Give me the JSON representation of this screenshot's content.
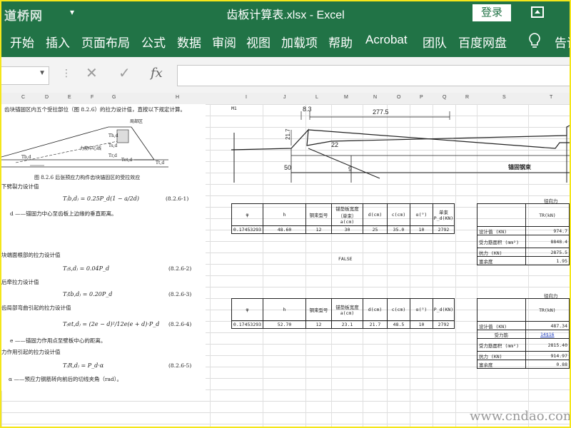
{
  "titlebar": {
    "logo": "道桥网",
    "qat": "▾",
    "title": "齿板计算表.xlsx  -  Excel",
    "login": "登录"
  },
  "ribbon": {
    "tabs": [
      "开始",
      "插入",
      "页面布局",
      "公式",
      "数据",
      "审阅",
      "视图",
      "加载项",
      "帮助",
      "Acrobat",
      "团队",
      "百度网盘",
      "告诉"
    ]
  },
  "formula_bar": {
    "fx": "fx",
    "cancel": "✕",
    "enter": "✓"
  },
  "columns": [
    "C",
    "D",
    "E",
    "F",
    "G",
    "H",
    "I",
    "J",
    "L",
    "M",
    "N",
    "O",
    "P",
    "Q",
    "R",
    "S",
    "T"
  ],
  "book": {
    "lines": [
      "齿块锚固区内五个受拉部位（图 8.2.6）的拉力设计值，直按以下规定计算。",
      "局部区",
      "力筋中心线",
      "图 8.2.6  后张预应力构件齿块锚固区的受拉效应",
      "下劈裂力设计值",
      "d ——锚固力中心至齿板上边缘的垂直距离。",
      "块端面根部的拉力设计值",
      "后牵拉力设计值",
      "齿局部弯曲引起的拉力设计值",
      "e ——锚固力作用点至壁板中心的距离。",
      "力作用引起的拉力设计值",
      "α ——预应力钢筋转向前后的切线夹角（rad）。"
    ],
    "formulas": [
      "T₍b,d₎ = 0.25P_d(1 − a/2d)",
      "T₍s,d₎ = 0.04P_d",
      "T₍tb,d₎ = 0.20P_d",
      "T₍et,d₎ = (2e − d)²/12e(e + d)·P_d",
      "T₍R,d₎ = P_d·α"
    ],
    "eq_numbers": [
      "(8.2.6-1)",
      "(8.2.6-2)",
      "(8.2.6-3)",
      "(8.2.6-4)",
      "(8.2.6-5)"
    ]
  },
  "drawing": {
    "cell_ref": "M1",
    "dims": [
      "8.3",
      "277.5",
      "21.7",
      "22",
      "50",
      "9"
    ],
    "label": "锚固钢束"
  },
  "table1": {
    "headers": [
      "φ",
      "h",
      "钢束型号",
      "锚垫板宽度（单束）a(cm)",
      "d(cm)",
      "c(cm)",
      "α(°)",
      "单束 P_d(KN)"
    ],
    "values": [
      "0.17453293",
      "48.60",
      "12",
      "30",
      "25",
      "35.0",
      "10",
      "2792"
    ]
  },
  "table2": {
    "headers": [
      "φ",
      "h",
      "钢束型号",
      "锚垫板宽度 a(cm)",
      "d(cm)",
      "c(cm)",
      "α(°)",
      "P_d(KN)"
    ],
    "values": [
      "0.17453293",
      "52.70",
      "12",
      "23.1",
      "21.7",
      "48.5",
      "10",
      "2792"
    ]
  },
  "false_text": "FALSE",
  "result1": {
    "caption": "径向力",
    "header": "TR(kN)",
    "rows": [
      [
        "设计值 (KN)",
        "974.7"
      ],
      [
        "受力筋面积 (mm²)",
        "8848.4"
      ],
      [
        "抗力 (KN)",
        "2875.5"
      ],
      [
        "富余度",
        "1.95"
      ]
    ]
  },
  "result2": {
    "caption": "径向力",
    "header": "TR(kN)",
    "rows": [
      [
        "设计值 (KN)",
        "487.34"
      ],
      [
        "受力筋",
        "14$16"
      ],
      [
        "受力筋面积 (mm²)",
        "2815.40"
      ],
      [
        "抗力 (KN)",
        "914.97"
      ],
      [
        "富余度",
        "0.88"
      ]
    ]
  },
  "watermark": "www.cndao.com",
  "colors": {
    "excel_green": "#217346",
    "frame_yellow": "#f4e61a"
  }
}
